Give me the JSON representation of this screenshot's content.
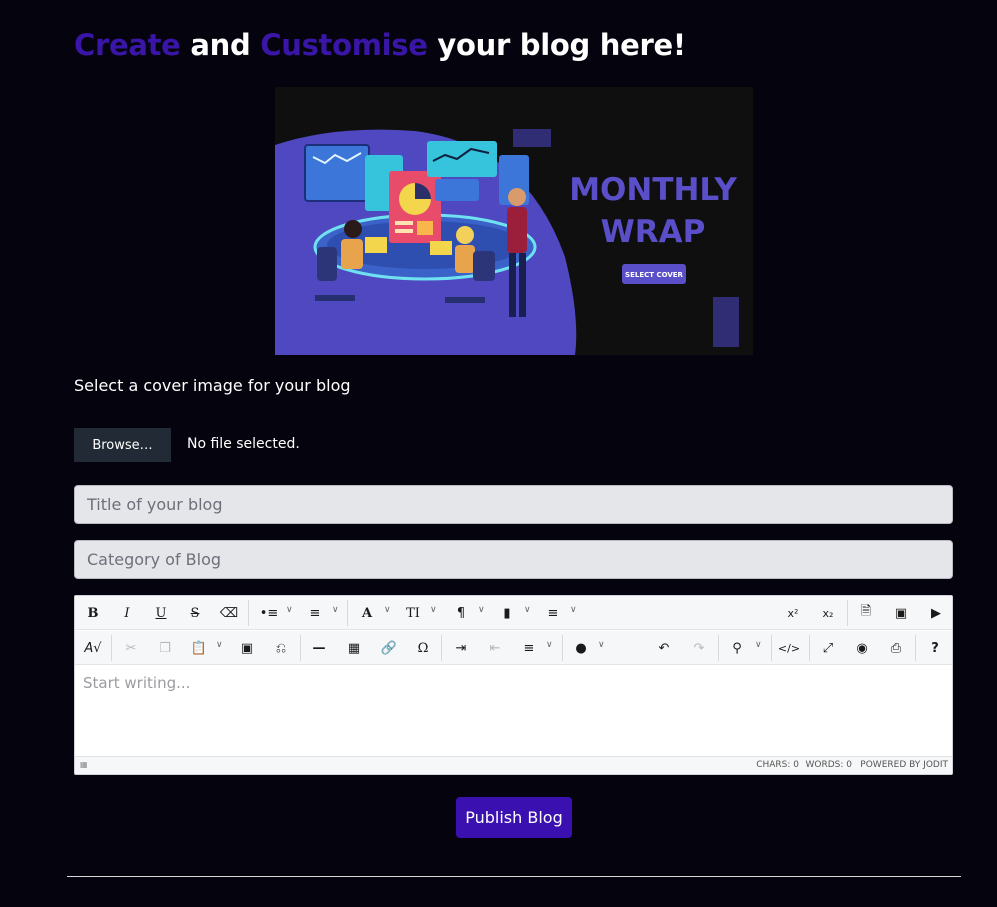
{
  "heading": {
    "part1": "Create",
    "part2": " and ",
    "part3": "Customise",
    "part4": " your blog here!"
  },
  "cover": {
    "title_line1": "MONTHLY",
    "title_line2": "WRAP",
    "button": "SELECT COVER"
  },
  "cover_label": "Select a cover image for your blog",
  "file_picker": {
    "button": "Browse…",
    "status": "No file selected."
  },
  "inputs": {
    "title_placeholder": "Title of your blog",
    "category_placeholder": "Category of Blog"
  },
  "editor": {
    "toolbar_row1": {
      "bold": "B",
      "italic": "I",
      "underline": "U",
      "strike": "S",
      "font": "A",
      "fontsize": "TI",
      "paragraph": "¶",
      "superscript": "x²",
      "subscript": "x₂"
    },
    "toolbar_row2": {
      "symbol": "Ω",
      "help": "?"
    },
    "placeholder": "Start writing...",
    "status": {
      "chars": "CHARS: 0",
      "words": "WORDS: 0",
      "powered": "POWERED BY JODIT"
    }
  },
  "publish_button": "Publish Blog",
  "colors": {
    "background": "#05040e",
    "accent": "#3a16a8",
    "publish": "#3b10b0",
    "cover_text": "#5a4fc8"
  }
}
